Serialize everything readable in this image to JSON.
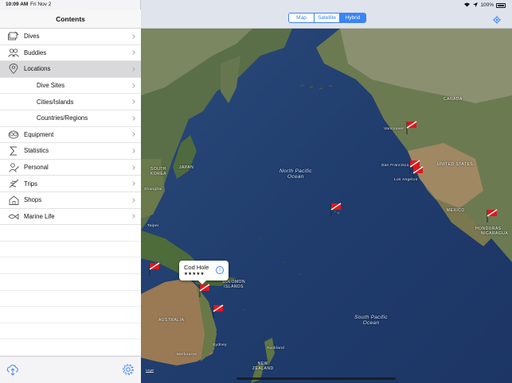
{
  "status_bar": {
    "time": "10:09 AM",
    "date": "Fri Nov 2",
    "battery": "100%"
  },
  "sidebar": {
    "title": "Contents",
    "items": [
      {
        "label": "Dives",
        "icon": "dives-icon",
        "selected": false,
        "sub": false
      },
      {
        "label": "Buddies",
        "icon": "buddies-icon",
        "selected": false,
        "sub": false
      },
      {
        "label": "Locations",
        "icon": "location-pin-icon",
        "selected": true,
        "sub": false
      },
      {
        "label": "Dive Sites",
        "icon": "",
        "selected": false,
        "sub": true
      },
      {
        "label": "Cities/Islands",
        "icon": "",
        "selected": false,
        "sub": true
      },
      {
        "label": "Countries/Regions",
        "icon": "",
        "selected": false,
        "sub": true
      },
      {
        "label": "Equipment",
        "icon": "equipment-icon",
        "selected": false,
        "sub": false
      },
      {
        "label": "Statistics",
        "icon": "sigma-icon",
        "selected": false,
        "sub": false
      },
      {
        "label": "Personal",
        "icon": "person-icon",
        "selected": false,
        "sub": false
      },
      {
        "label": "Trips",
        "icon": "airplane-icon",
        "selected": false,
        "sub": false
      },
      {
        "label": "Shops",
        "icon": "shop-icon",
        "selected": false,
        "sub": false
      },
      {
        "label": "Marine Life",
        "icon": "fish-icon",
        "selected": false,
        "sub": false
      }
    ],
    "footer": {
      "left_icon": "cloud-sync-icon",
      "right_icon": "gear-icon"
    }
  },
  "map": {
    "segments": [
      "Map",
      "Satellite",
      "Hybrid"
    ],
    "selected_segment": "Hybrid",
    "accent": "#3a84f5",
    "labels": {
      "north_pacific": [
        "North Pacific",
        "Ocean"
      ],
      "south_pacific": [
        "South Pacific",
        "Ocean"
      ],
      "canada": "CANADA",
      "united_states": "UNITED STATES",
      "mexico": "MEXICO",
      "honduras": "HONDURAS",
      "nicaragua": "NICARAGUA",
      "japan": "JAPAN",
      "south_korea": [
        "SOUTH",
        "KOREA"
      ],
      "shanghai": "Shanghai",
      "australia": "AUSTRALIA",
      "solomon": [
        "SOLOMON",
        "ISLANDS"
      ],
      "new_zealand": [
        "NEW",
        "ZEALAND"
      ],
      "vancouver": "Vancouver",
      "san_francisco": "San Francisco",
      "los_angeles": "Los Angeles",
      "sydney": "Sydney",
      "melbourne": "Melbourne",
      "auckland": "Auckland",
      "taipei": "Taipei",
      "legal": "Legal"
    },
    "callout": {
      "title": "Cod Hole",
      "rating": "★★★★★"
    },
    "flag_color": "#e0161b"
  }
}
